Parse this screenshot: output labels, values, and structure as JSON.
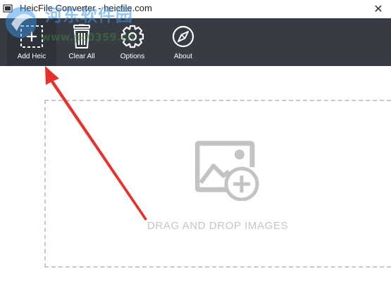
{
  "window": {
    "title": "HeicFile Converter - heicfile.com",
    "close_glyph": "✕"
  },
  "watermark": {
    "text_cn": "河东软件园",
    "text_url": "www.pc0359.cn"
  },
  "toolbar": {
    "items": [
      {
        "label": "Add Heic",
        "icon": "add-image-icon",
        "active": true
      },
      {
        "label": "Clear All",
        "icon": "trash-icon",
        "active": false
      },
      {
        "label": "Options",
        "icon": "gear-icon",
        "active": false
      },
      {
        "label": "About",
        "icon": "compass-icon",
        "active": false
      }
    ]
  },
  "dropzone": {
    "text": "DRAG AND DROP IMAGES",
    "icon": "image-add-icon"
  },
  "colors": {
    "toolbar_bg": "#363b44",
    "annotation_arrow": "#e8312a",
    "dropzone_border": "#c8c8c8",
    "dropzone_text": "#c5c5c5"
  }
}
